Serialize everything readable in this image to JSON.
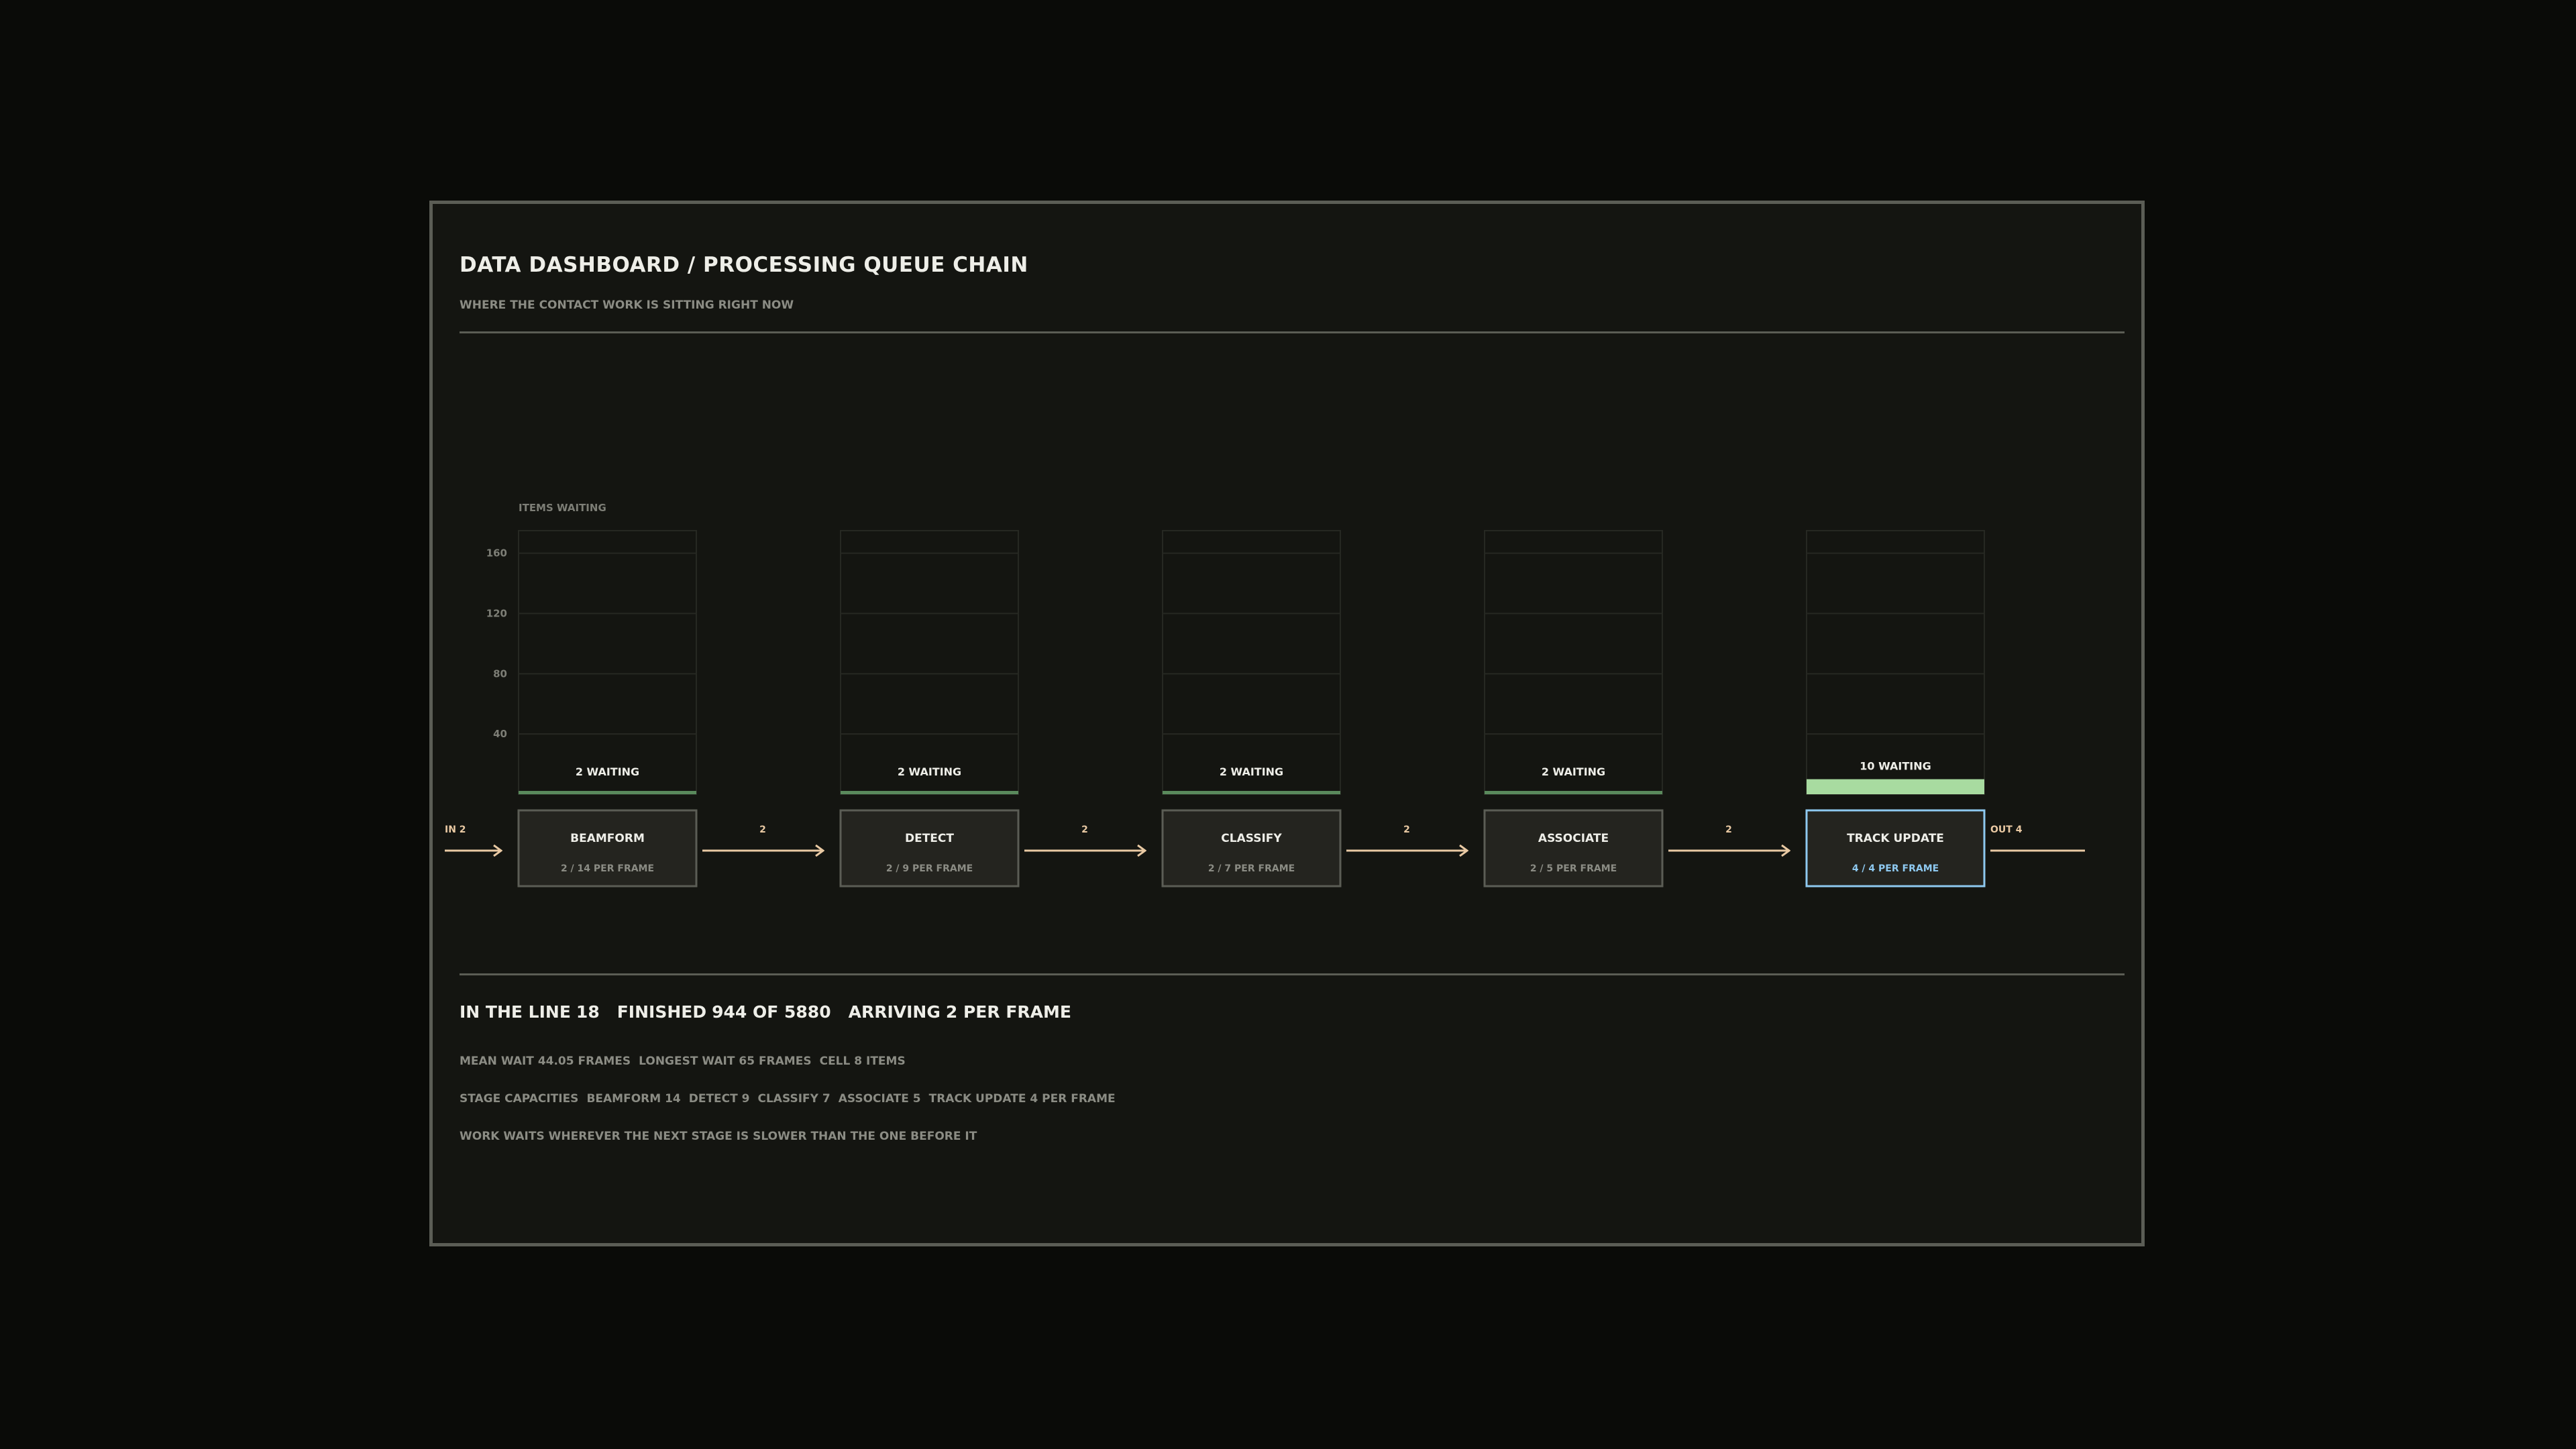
{
  "header": {
    "title": "DATA DASHBOARD / PROCESSING QUEUE CHAIN",
    "subtitle": "WHERE THE CONTACT WORK IS SITTING RIGHT NOW"
  },
  "chart": {
    "y_axis_label": "ITEMS WAITING",
    "y_ticks": [
      "160",
      "120",
      "80",
      "40"
    ],
    "y_max": 175
  },
  "colors": {
    "queue_bar": "#5a8a5c",
    "queue_bar_highlight": "#a8dba0",
    "arrow": "#e9c9a3",
    "node_border": "#5b5d55",
    "node_highlight_border": "#8ec9f0",
    "node_highlight_text": "#8ec9f0"
  },
  "flow": {
    "in_label": "IN 2",
    "out_label": "OUT 4",
    "edge_labels": [
      "2",
      "2",
      "2",
      "2"
    ]
  },
  "stages": [
    {
      "name": "BEAMFORM",
      "rate": "2 / 14 PER FRAME",
      "waiting": 2,
      "waiting_label": "2 WAITING",
      "highlight": false
    },
    {
      "name": "DETECT",
      "rate": "2 / 9 PER FRAME",
      "waiting": 2,
      "waiting_label": "2 WAITING",
      "highlight": false
    },
    {
      "name": "CLASSIFY",
      "rate": "2 / 7 PER FRAME",
      "waiting": 2,
      "waiting_label": "2 WAITING",
      "highlight": false
    },
    {
      "name": "ASSOCIATE",
      "rate": "2 / 5 PER FRAME",
      "waiting": 2,
      "waiting_label": "2 WAITING",
      "highlight": false
    },
    {
      "name": "TRACK UPDATE",
      "rate": "4 / 4 PER FRAME",
      "waiting": 10,
      "waiting_label": "10 WAITING",
      "highlight": true
    }
  ],
  "summary": {
    "in_line_label": "IN THE LINE",
    "in_line_value": "18",
    "finished_label": "FINISHED",
    "finished_value": "944 OF 5880",
    "arriving_label": "ARRIVING",
    "arriving_value": "2 PER FRAME"
  },
  "stats": {
    "mean_wait": "MEAN WAIT 44.05 FRAMES",
    "longest_wait": "LONGEST WAIT 65 FRAMES",
    "cell": "CELL 8 ITEMS",
    "capacities_label": "STAGE CAPACITIES",
    "capacities": [
      "BEAMFORM 14",
      "DETECT 9",
      "CLASSIFY 7",
      "ASSOCIATE 5",
      "TRACK UPDATE 4 PER FRAME"
    ],
    "note": "WORK WAITS WHEREVER THE NEXT STAGE IS SLOWER THAN THE ONE BEFORE IT"
  }
}
